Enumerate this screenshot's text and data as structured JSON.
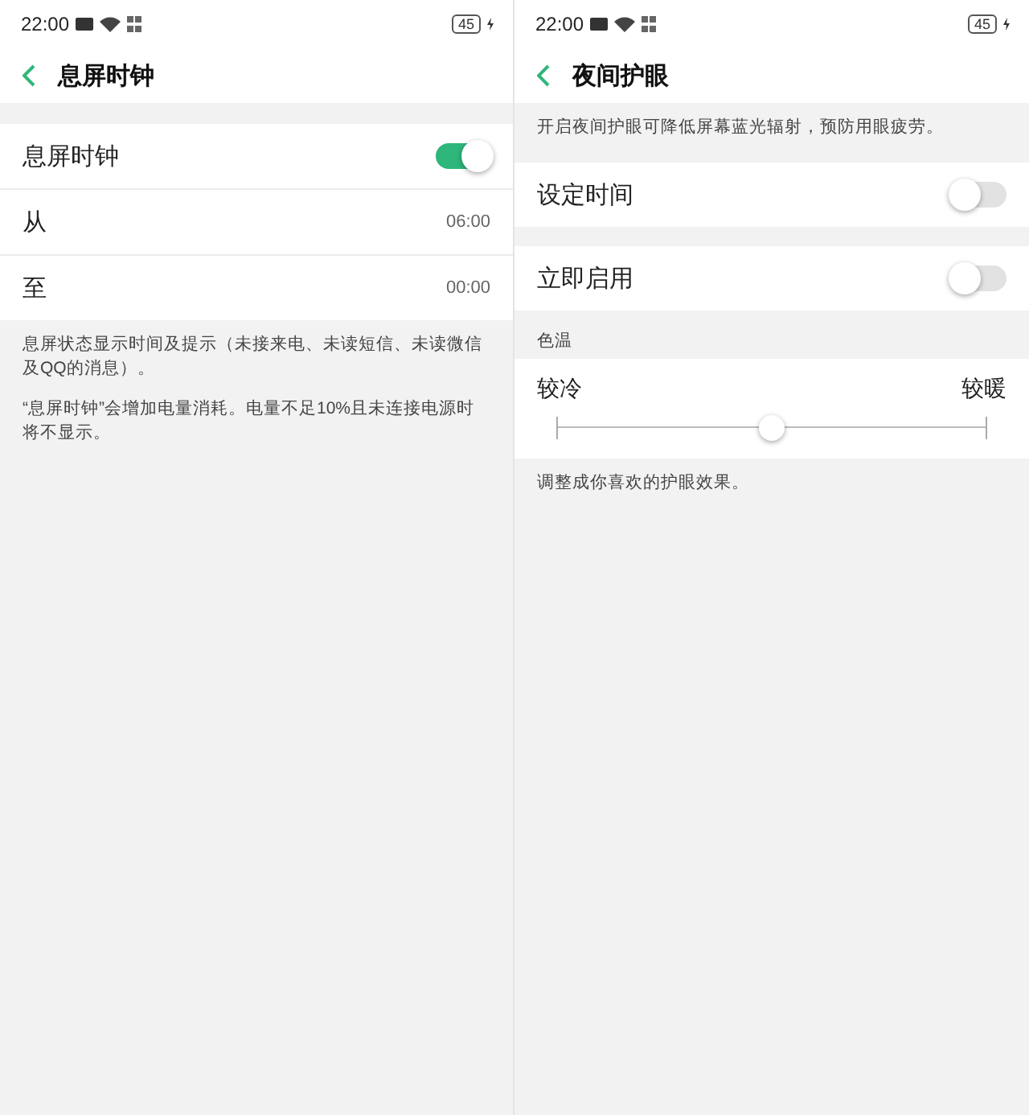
{
  "screens": [
    {
      "status_bar": {
        "time": "22:00",
        "battery": "45"
      },
      "title": "息屏时钟",
      "sections": [
        {
          "kind": "group",
          "rows": [
            {
              "kind": "toggle",
              "label": "息屏时钟",
              "on": true
            },
            {
              "kind": "value",
              "label": "从",
              "value": "06:00"
            },
            {
              "kind": "value",
              "label": "至",
              "value": "00:00"
            }
          ]
        },
        {
          "kind": "note",
          "text": "息屏状态显示时间及提示（未接来电、未读短信、未读微信及QQ的消息）。"
        },
        {
          "kind": "note",
          "text": "“息屏时钟”会增加电量消耗。电量不足10%且未连接电源时将不显示。"
        }
      ]
    },
    {
      "status_bar": {
        "time": "22:00",
        "battery": "45"
      },
      "title": "夜间护眼",
      "sections": [
        {
          "kind": "note",
          "text": "开启夜间护眼可降低屏幕蓝光辐射，预防用眼疲劳。"
        },
        {
          "kind": "group",
          "rows": [
            {
              "kind": "toggle",
              "label": "设定时间",
              "on": false
            }
          ]
        },
        {
          "kind": "group",
          "rows": [
            {
              "kind": "toggle",
              "label": "立即启用",
              "on": false
            }
          ]
        },
        {
          "kind": "label",
          "text": "色温"
        },
        {
          "kind": "slider",
          "min_label": "较冷",
          "max_label": "较暖",
          "level": 0.5
        },
        {
          "kind": "note",
          "text": "调整成你喜欢的护眼效果。"
        }
      ]
    }
  ]
}
